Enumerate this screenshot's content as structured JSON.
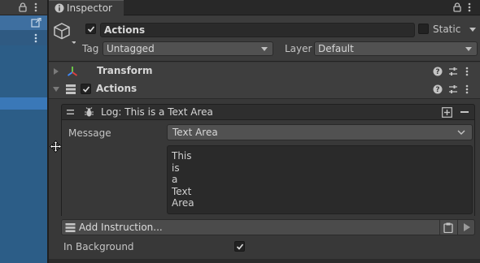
{
  "tab": {
    "label": "Inspector"
  },
  "header": {
    "object_name": "Actions",
    "static_label": "Static",
    "tag_label": "Tag",
    "tag_value": "Untagged",
    "layer_label": "Layer",
    "layer_value": "Default"
  },
  "components": {
    "transform": {
      "label": "Transform"
    },
    "actions": {
      "label": "Actions"
    }
  },
  "instruction": {
    "title": "Log: This is a Text Area",
    "message_label": "Message",
    "message_type": "Text Area",
    "message_lines": [
      "This",
      "is",
      "a",
      "Text",
      "Area"
    ]
  },
  "add_instruction_label": "Add Instruction...",
  "in_background_label": "In Background",
  "colors": {
    "accent_selection": "#3a78b8",
    "panel": "#383838"
  }
}
